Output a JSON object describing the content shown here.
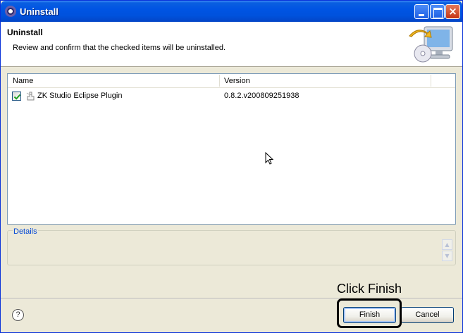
{
  "window": {
    "title": "Uninstall"
  },
  "banner": {
    "title": "Uninstall",
    "description": "Review and confirm that the checked items will be uninstalled."
  },
  "table": {
    "columns": [
      "Name",
      "Version"
    ],
    "rows": [
      {
        "checked": true,
        "name": "ZK Studio Eclipse Plugin",
        "version": "0.8.2.v200809251938"
      }
    ]
  },
  "details": {
    "label": "Details"
  },
  "buttons": {
    "help": "?",
    "finish": "Finish",
    "cancel": "Cancel"
  },
  "annotation": {
    "text": "Click Finish"
  }
}
